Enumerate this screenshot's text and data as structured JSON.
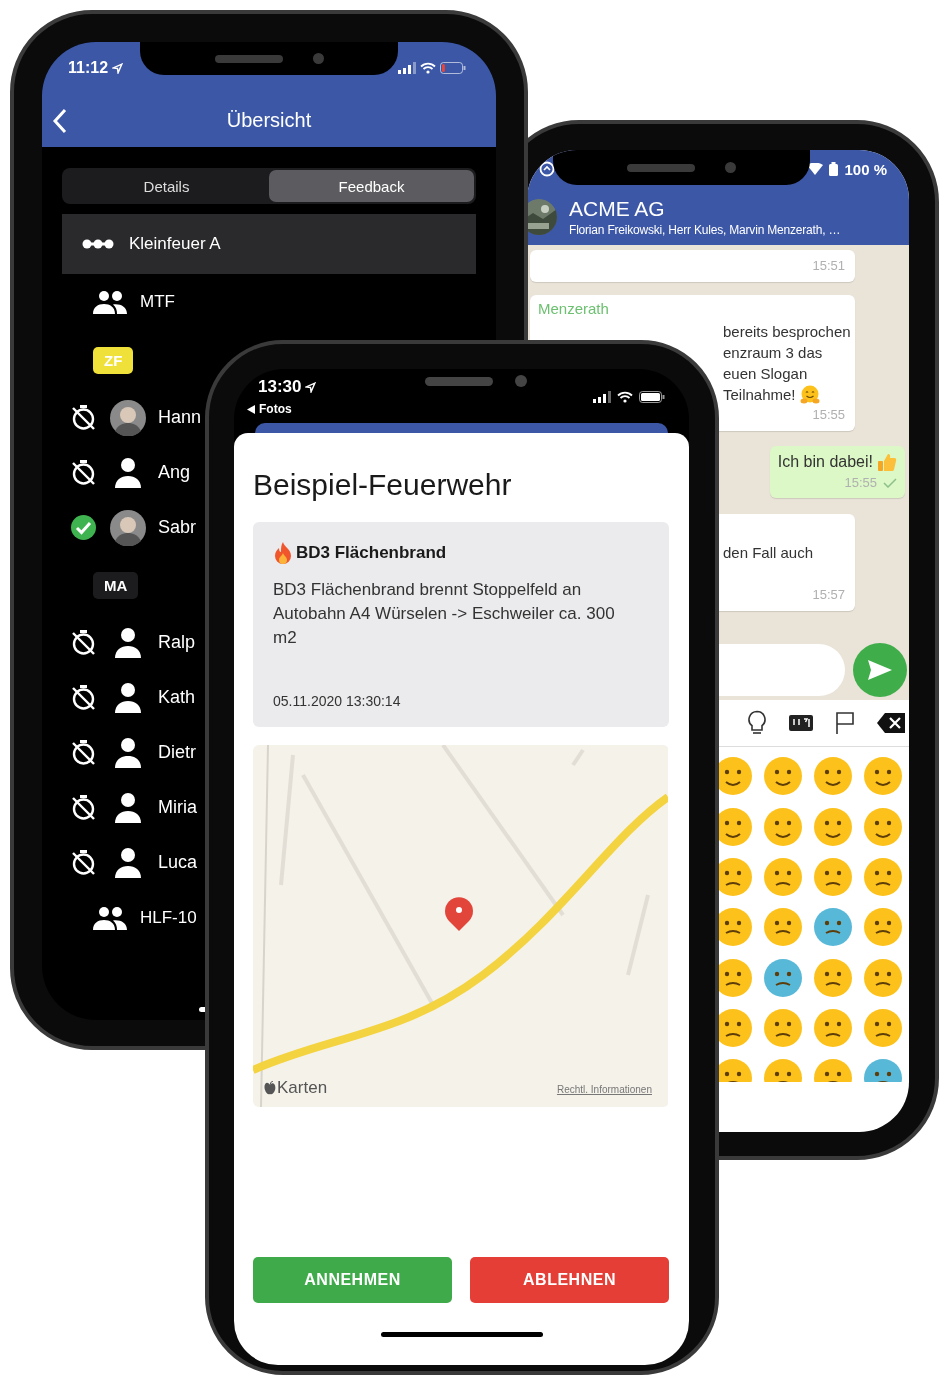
{
  "overview_phone": {
    "status": {
      "time": "11:12"
    },
    "header": {
      "title": "Übersicht"
    },
    "tabs": [
      {
        "label": "Details",
        "selected": false
      },
      {
        "label": "Feedback",
        "selected": true
      }
    ],
    "event": {
      "label": "Kleinfeuer A"
    },
    "entries": [
      {
        "kind": "unit",
        "label": "MTF"
      },
      {
        "kind": "badge",
        "label": "ZF",
        "color": "#efe03a"
      },
      {
        "kind": "person",
        "name": "Hann",
        "accepted": false,
        "photo": true
      },
      {
        "kind": "person",
        "name": "Ang",
        "accepted": false,
        "photo": false
      },
      {
        "kind": "person",
        "name": "Sabr",
        "accepted": true,
        "photo": true
      },
      {
        "kind": "badge",
        "label": "MA",
        "color": "#1c1c1e"
      },
      {
        "kind": "person",
        "name": "Ralp",
        "accepted": false,
        "photo": false
      },
      {
        "kind": "person",
        "name": "Kath",
        "accepted": false,
        "photo": false
      },
      {
        "kind": "person",
        "name": "Dietr",
        "accepted": false,
        "photo": false
      },
      {
        "kind": "person",
        "name": "Miria",
        "accepted": false,
        "photo": false
      },
      {
        "kind": "person",
        "name": "Luca",
        "accepted": false,
        "photo": false
      },
      {
        "kind": "unit",
        "label": "HLF-10"
      }
    ]
  },
  "chat_phone": {
    "status": {
      "battery": "100 %"
    },
    "header": {
      "title": "ACME AG",
      "members": "Florian Freikowski, Herr Kules, Marvin Menzerath, …"
    },
    "messages": [
      {
        "kind": "incoming",
        "time": "15:51"
      },
      {
        "kind": "incoming",
        "sender": "Menzerath",
        "lines": [
          "bereits besprochen",
          "enzraum 3 das",
          "euen Slogan",
          "Teilnahme!"
        ],
        "emoji": true,
        "time": "15:55"
      },
      {
        "kind": "outgoing",
        "lines": [
          "Ich bin dabei!"
        ],
        "emoji": true,
        "time": "15:55",
        "sent": true
      },
      {
        "kind": "incoming",
        "lines": [
          "den Fall auch"
        ],
        "time": "15:57"
      }
    ]
  },
  "alert_phone": {
    "status": {
      "time": "13:30",
      "back": "Fotos"
    },
    "title": "Beispiel-Feuerwehr",
    "alarm": {
      "title": "BD3 Flächenbrand",
      "text": "BD3 Flächenbrand brennt Stoppelfeld an Autobahn A4 Würselen -> Eschweiler ca. 300 m2",
      "timestamp": "05.11.2020 13:30:14"
    },
    "map": {
      "kind": "picture",
      "brand": "Karten",
      "legal_link": "Rechtl. Informationen"
    },
    "buttons": [
      {
        "kind": "accept",
        "label": "ANNEHMEN"
      },
      {
        "kind": "decline",
        "label": "ABLEHNEN"
      }
    ]
  }
}
